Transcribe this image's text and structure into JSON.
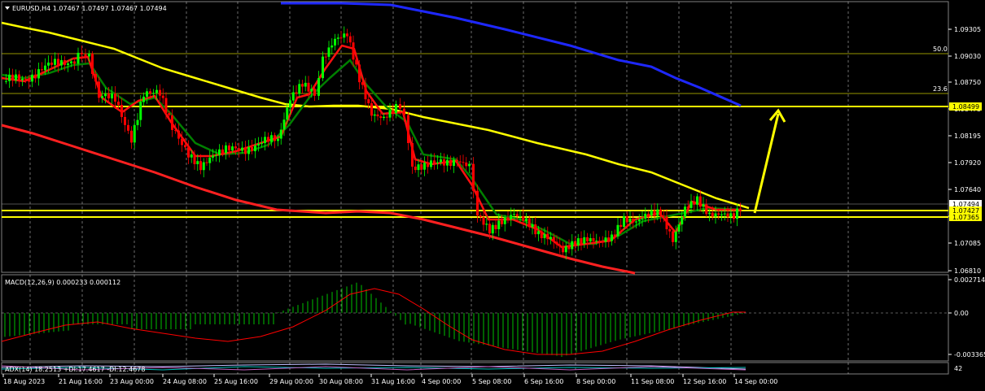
{
  "symbol_header": "EURUSD,H4  1.07467 1.07497 1.07467 1.07494",
  "price_axis": {
    "ticks": [
      "1.09305",
      "1.09030",
      "1.08750",
      "1.08475",
      "1.08195",
      "1.07920",
      "1.07640",
      "1.07360",
      "1.07085",
      "1.06810"
    ],
    "badges": [
      {
        "label": "1.08499",
        "bg": "#ffff00",
        "fg": "#000000"
      },
      {
        "label": "1.07494",
        "bg": "#ffffff",
        "fg": "#000000"
      },
      {
        "label": "1.07427",
        "bg": "#ffff00",
        "fg": "#000000"
      },
      {
        "label": "1.07365",
        "bg": "#ffff00",
        "fg": "#000000"
      }
    ]
  },
  "fib_labels": [
    "50.0",
    "23.6"
  ],
  "macd": {
    "header": "MACD(12,26,9) 0.000233 0.000112",
    "ticks": [
      "0.002714",
      "0.00",
      "-0.003365"
    ]
  },
  "adx": {
    "header": "ADX(14) 18.2513 +DI:17.4617 -DI:12.4678",
    "ticks": [
      "42"
    ]
  },
  "time_axis": {
    "labels": [
      "18 Aug 2023",
      "21 Aug 16:00",
      "23 Aug 00:00",
      "24 Aug 08:00",
      "25 Aug 16:00",
      "29 Aug 00:00",
      "30 Aug 08:00",
      "31 Aug 16:00",
      "4 Sep 00:00",
      "5 Sep 08:00",
      "6 Sep 16:00",
      "8 Sep 00:00",
      "11 Sep 08:00",
      "12 Sep 16:00",
      "14 Sep 00:00"
    ]
  },
  "colors": {
    "bull": "#00ff00",
    "bear": "#ff0000",
    "ma_yellow": "#ffff00",
    "ma_blue": "#0000ff",
    "ma_red": "#ff0000",
    "ma_green": "#008000",
    "macd_hist": "#00c000",
    "macd_signal": "#ff0000",
    "grid": "#ffffff"
  }
}
